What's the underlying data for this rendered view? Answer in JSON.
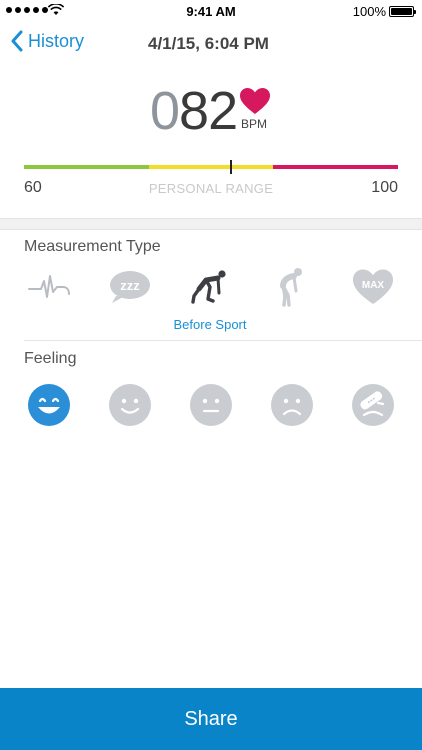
{
  "status_bar": {
    "time": "9:41 AM",
    "battery": "100%"
  },
  "nav": {
    "back_label": "History",
    "title": "4/1/15, 6:04 PM"
  },
  "bpm": {
    "lead": "0",
    "value": "82",
    "unit": "BPM",
    "heart_color": "#d6195e"
  },
  "range": {
    "min": "60",
    "max": "100",
    "label": "PERSONAL RANGE",
    "marker_fraction": 0.55
  },
  "measurement_type": {
    "title": "Measurement Type",
    "items": [
      {
        "icon": "heartbeat-icon",
        "label": "Resting Pulse"
      },
      {
        "icon": "sleep-zzz-icon",
        "label": "Sleep"
      },
      {
        "icon": "runner-start-icon",
        "label": "Before Sport"
      },
      {
        "icon": "exhausted-runner-icon",
        "label": "After Sport"
      },
      {
        "icon": "max-heart-icon",
        "label": "MAX"
      }
    ],
    "selected_index": 2,
    "selected_label": "Before Sport",
    "max_text": "MAX",
    "sleep_text": "zzz"
  },
  "feeling": {
    "title": "Feeling",
    "items": [
      "very-happy-face-icon",
      "smiling-face-icon",
      "neutral-face-icon",
      "sad-face-icon",
      "sick-bandaged-face-icon"
    ],
    "selected_index": 0
  },
  "colors": {
    "accent": "#0a84c9",
    "link": "#1a8fd6",
    "icon_gray": "#c9ccd1",
    "selected": "#2b8fd8"
  },
  "share_label": "Share"
}
